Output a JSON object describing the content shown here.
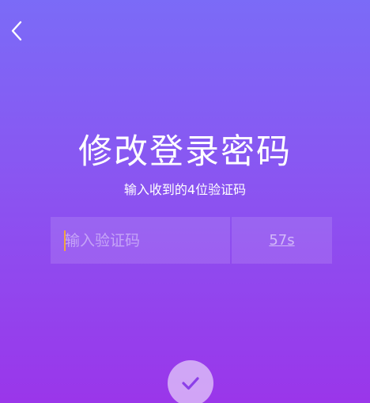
{
  "header": {
    "back_icon": "chevron-left-icon"
  },
  "main": {
    "title": "修改登录密码",
    "subtitle": "输入收到的4位验证码",
    "code_input": {
      "placeholder": "输入验证码",
      "value": ""
    },
    "countdown": "57s",
    "confirm_icon": "checkmark-icon"
  },
  "colors": {
    "gradient_top": "#7b6bf7",
    "gradient_bottom": "#9a36ea",
    "caret": "#f0a640"
  }
}
